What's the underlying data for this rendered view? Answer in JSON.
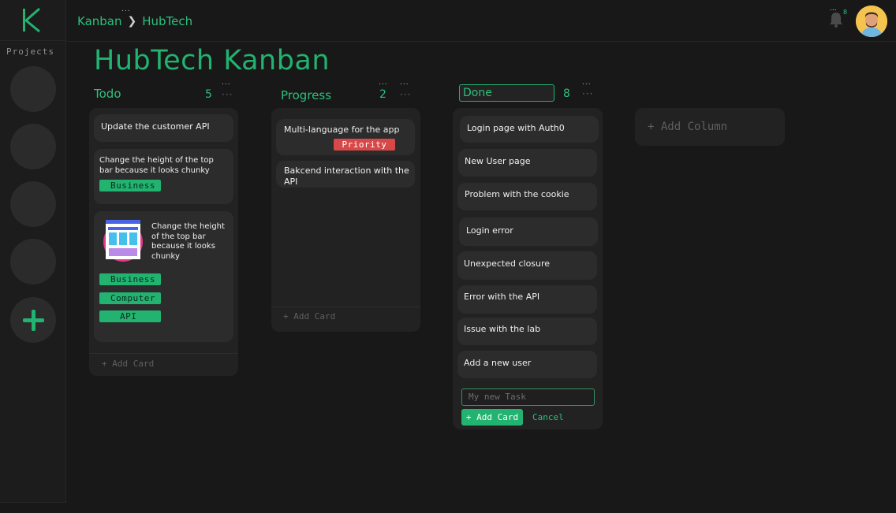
{
  "sidebar": {
    "projects_label": "Projects",
    "logo_letter": "K"
  },
  "header": {
    "breadcrumb": [
      "Kanban",
      "HubTech"
    ],
    "crumb_dots": "...",
    "bell_dots": "...",
    "notification_count": "8"
  },
  "page": {
    "title": "HubTech Kanban"
  },
  "columns": [
    {
      "title": "Todo",
      "count": "5",
      "menu": "···",
      "dots": "...",
      "cards": [
        {
          "text": "Update the customer API"
        },
        {
          "text": "Change the height of the top bar because it looks chunky",
          "tags": [
            "Business"
          ]
        },
        {
          "text": "Change the height of the top bar because it looks chunky",
          "tags": [
            "Business",
            "Computer",
            "API"
          ]
        }
      ],
      "add_label": "+ Add Card"
    },
    {
      "title": "Progress",
      "count": "2",
      "menu": "···",
      "dots": "...",
      "count_dots": "...",
      "cards": [
        {
          "text": "Multi-language for the app",
          "tags": [
            "Priority"
          ]
        },
        {
          "text": "Bakcend interaction with the API"
        }
      ],
      "add_label": "+ Add Card"
    },
    {
      "title": "Done",
      "count": "8",
      "menu": "···",
      "dots": "...",
      "cards": [
        {
          "text": "Login page with Auth0"
        },
        {
          "text": "New User page"
        },
        {
          "text": "Problem with the cookie"
        },
        {
          "text": "Login error"
        },
        {
          "text": "Unexpected closure"
        },
        {
          "text": "Error with the API"
        },
        {
          "text": "Issue with the lab"
        },
        {
          "text": "Add a new user"
        }
      ],
      "new_task_placeholder": "My new Task",
      "add_button": "+ Add Card",
      "cancel_button": "Cancel"
    }
  ],
  "add_column_label": "+ Add Column",
  "colors": {
    "accent": "#21b36f",
    "priority": "#d94848",
    "background": "#181818"
  }
}
